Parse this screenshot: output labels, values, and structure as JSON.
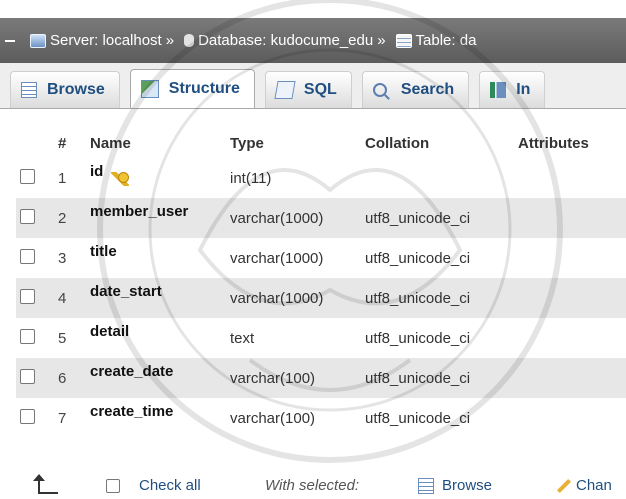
{
  "breadcrumb": {
    "server": "Server: localhost",
    "database": "Database: kudocume_edu",
    "table": "Table: da",
    "separator": "»"
  },
  "tabs": [
    {
      "label": "Browse",
      "icon": "browse-icon"
    },
    {
      "label": "Structure",
      "icon": "structure-icon"
    },
    {
      "label": "SQL",
      "icon": "sql-icon"
    },
    {
      "label": "Search",
      "icon": "search-icon"
    },
    {
      "label": "In",
      "icon": "insert-icon"
    }
  ],
  "columns": [
    "#",
    "Name",
    "Type",
    "Collation",
    "Attributes"
  ],
  "rows": [
    {
      "num": "1",
      "name": "id",
      "type": "int(11)",
      "collation": ""
    },
    {
      "num": "2",
      "name": "member_user",
      "type": "varchar(1000)",
      "collation": "utf8_unicode_ci"
    },
    {
      "num": "3",
      "name": "title",
      "type": "varchar(1000)",
      "collation": "utf8_unicode_ci"
    },
    {
      "num": "4",
      "name": "date_start",
      "type": "varchar(1000)",
      "collation": "utf8_unicode_ci"
    },
    {
      "num": "5",
      "name": "detail",
      "type": "text",
      "collation": "utf8_unicode_ci"
    },
    {
      "num": "6",
      "name": "create_date",
      "type": "varchar(100)",
      "collation": "utf8_unicode_ci"
    },
    {
      "num": "7",
      "name": "create_time",
      "type": "varchar(100)",
      "collation": "utf8_unicode_ci"
    }
  ],
  "footer": {
    "check_all": "Check all",
    "with_selected": "With selected:",
    "browse": "Browse",
    "change": "Chan"
  }
}
